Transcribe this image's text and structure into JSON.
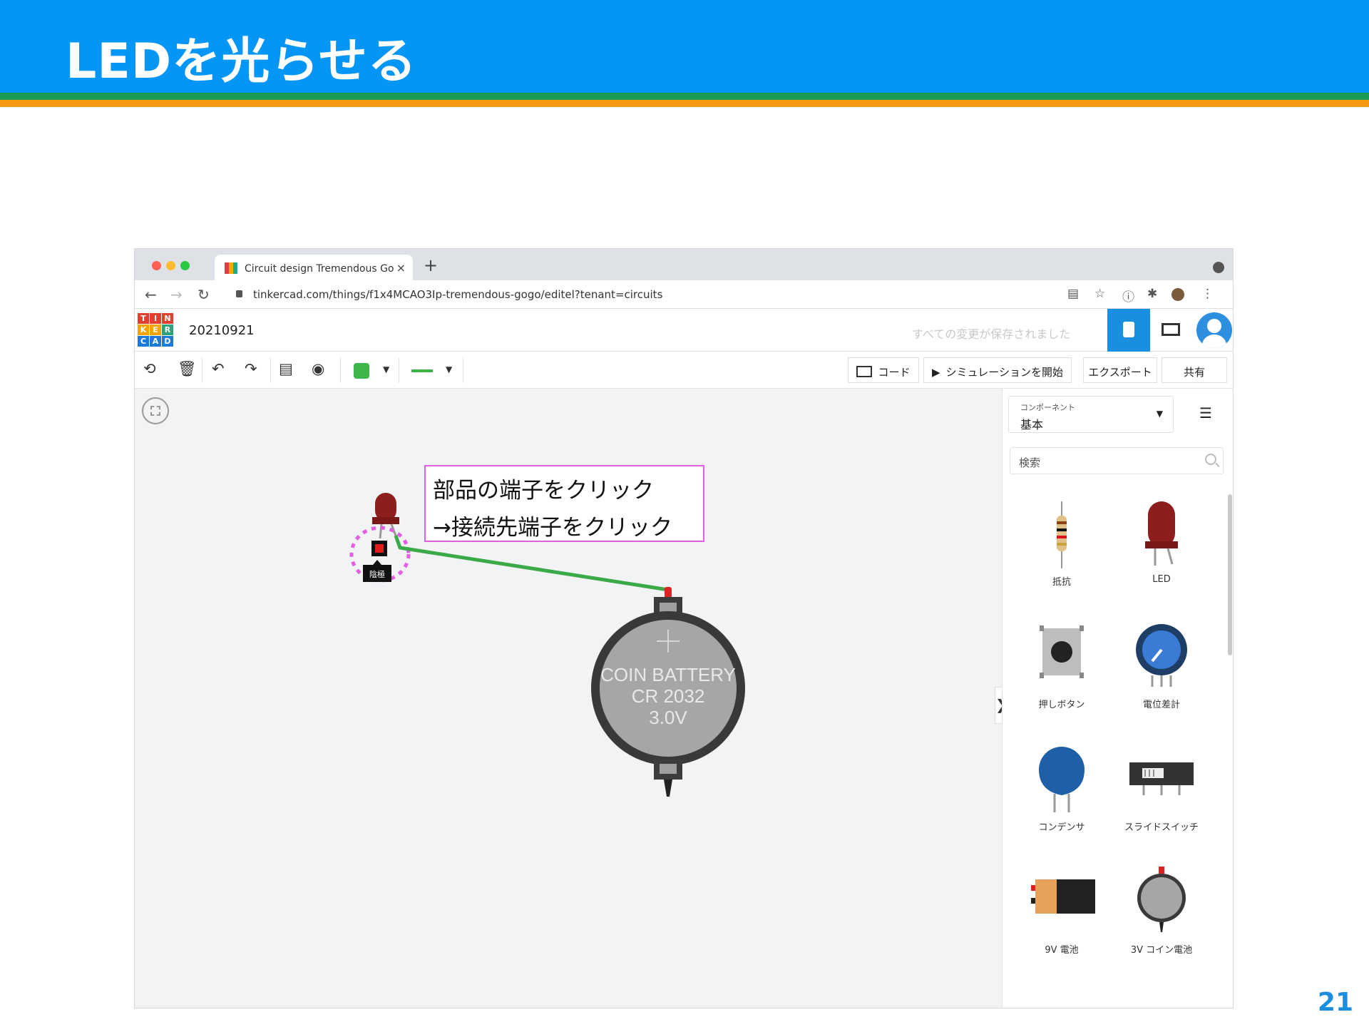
{
  "slide": {
    "title": "LEDを光らせる",
    "page_number": "21",
    "colors": {
      "header": "#0496f7",
      "band_green": "#1d9a55",
      "band_orange": "#f59a12"
    }
  },
  "browser": {
    "tab_title": "Circuit design Tremendous Go",
    "tab_close": "×",
    "new_tab": "+",
    "url": "tinkercad.com/things/f1x4MCAO3Ip-tremendous-gogo/editel?tenant=circuits"
  },
  "app": {
    "logo_letters": [
      "T",
      "I",
      "N",
      "K",
      "E",
      "R",
      "C",
      "A",
      "D"
    ],
    "project_name": "20210921",
    "save_status": "すべての変更が保存されました"
  },
  "toolbar": {
    "code_label": "コード",
    "simulate_label": "シミュレーションを開始",
    "export_label": "エクスポート",
    "share_label": "共有",
    "wire_color": "#3cb54a"
  },
  "callout": {
    "line1": "部品の端子をクリック",
    "line2": "→接続先端子をクリック"
  },
  "canvas": {
    "battery_text": [
      "COIN BATTERY",
      "CR 2032",
      "3.0V"
    ],
    "terminal_label": "陰極"
  },
  "panel": {
    "components_label": "コンポーネント",
    "components_value": "基本",
    "search_placeholder": "検索",
    "items": [
      {
        "label": "抵抗"
      },
      {
        "label": "LED"
      },
      {
        "label": "押しボタン"
      },
      {
        "label": "電位差計"
      },
      {
        "label": "コンデンサ"
      },
      {
        "label": "スライドスイッチ"
      },
      {
        "label": "9V 電池"
      },
      {
        "label": "3V コイン電池"
      }
    ]
  }
}
